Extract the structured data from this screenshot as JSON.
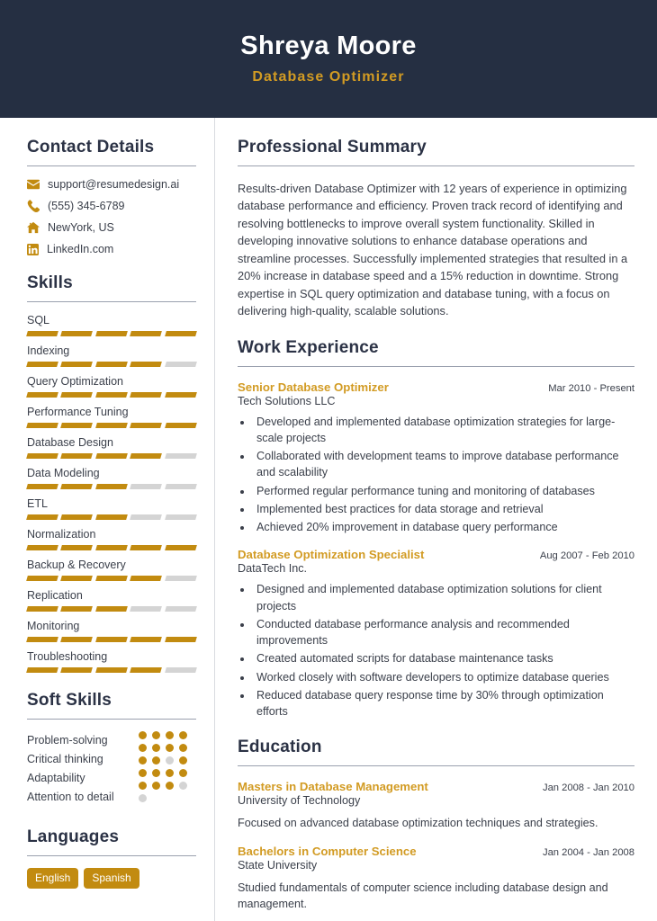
{
  "header": {
    "name": "Shreya Moore",
    "title": "Database Optimizer"
  },
  "theme": {
    "navy": "#252F42",
    "gold": "#C28B10",
    "gold_text": "#D29B23",
    "text": "#3a3f4a",
    "muted_bar": "#d4d4d4"
  },
  "sidebar": {
    "contact": {
      "heading": "Contact Details",
      "items": [
        {
          "icon": "envelope-icon",
          "value": "support@resumedesign.ai"
        },
        {
          "icon": "phone-icon",
          "value": "(555) 345-6789"
        },
        {
          "icon": "home-icon",
          "value": "NewYork, US"
        },
        {
          "icon": "linkedin-icon",
          "value": "LinkedIn.com"
        }
      ]
    },
    "skills": {
      "heading": "Skills",
      "max": 5,
      "items": [
        {
          "name": "SQL",
          "level": 5
        },
        {
          "name": "Indexing",
          "level": 4
        },
        {
          "name": "Query Optimization",
          "level": 5
        },
        {
          "name": "Performance Tuning",
          "level": 5
        },
        {
          "name": "Database Design",
          "level": 4
        },
        {
          "name": "Data Modeling",
          "level": 3
        },
        {
          "name": "ETL",
          "level": 3
        },
        {
          "name": "Normalization",
          "level": 5
        },
        {
          "name": "Backup & Recovery",
          "level": 4
        },
        {
          "name": "Replication",
          "level": 3
        },
        {
          "name": "Monitoring",
          "level": 5
        },
        {
          "name": "Troubleshooting",
          "level": 4
        }
      ]
    },
    "soft_skills": {
      "heading": "Soft Skills",
      "max": 5,
      "items": [
        {
          "name": "Problem-solving",
          "level": 5
        },
        {
          "name": "Critical thinking",
          "level": 5
        },
        {
          "name": "Adaptability",
          "level": 4
        },
        {
          "name": "Attention to detail",
          "level": 5
        }
      ],
      "dots_total": 21,
      "dots_filled": 19
    },
    "languages": {
      "heading": "Languages",
      "items": [
        "English",
        "Spanish"
      ]
    }
  },
  "main": {
    "summary": {
      "heading": "Professional Summary",
      "text": "Results-driven Database Optimizer with 12 years of experience in optimizing database performance and efficiency. Proven track record of identifying and resolving bottlenecks to improve overall system functionality. Skilled in developing innovative solutions to enhance database operations and streamline processes. Successfully implemented strategies that resulted in a 20% increase in database speed and a 15% reduction in downtime. Strong expertise in SQL query optimization and database tuning, with a focus on delivering high-quality, scalable solutions."
    },
    "experience": {
      "heading": "Work Experience",
      "items": [
        {
          "title": "Senior Database Optimizer",
          "date": "Mar 2010 - Present",
          "org": "Tech Solutions LLC",
          "bullets": [
            "Developed and implemented database optimization strategies for large-scale projects",
            "Collaborated with development teams to improve database performance and scalability",
            "Performed regular performance tuning and monitoring of databases",
            "Implemented best practices for data storage and retrieval",
            "Achieved 20% improvement in database query performance"
          ]
        },
        {
          "title": "Database Optimization Specialist",
          "date": "Aug 2007 - Feb 2010",
          "org": "DataTech Inc.",
          "bullets": [
            "Designed and implemented database optimization solutions for client projects",
            "Conducted database performance analysis and recommended improvements",
            "Created automated scripts for database maintenance tasks",
            "Worked closely with software developers to optimize database queries",
            "Reduced database query response time by 30% through optimization efforts"
          ]
        }
      ]
    },
    "education": {
      "heading": "Education",
      "items": [
        {
          "title": "Masters in Database Management",
          "date": "Jan 2008 - Jan 2010",
          "org": "University of Technology",
          "desc": "Focused on advanced database optimization techniques and strategies."
        },
        {
          "title": "Bachelors in Computer Science",
          "date": "Jan 2004 - Jan 2008",
          "org": "State University",
          "desc": "Studied fundamentals of computer science including database design and management."
        }
      ]
    }
  }
}
